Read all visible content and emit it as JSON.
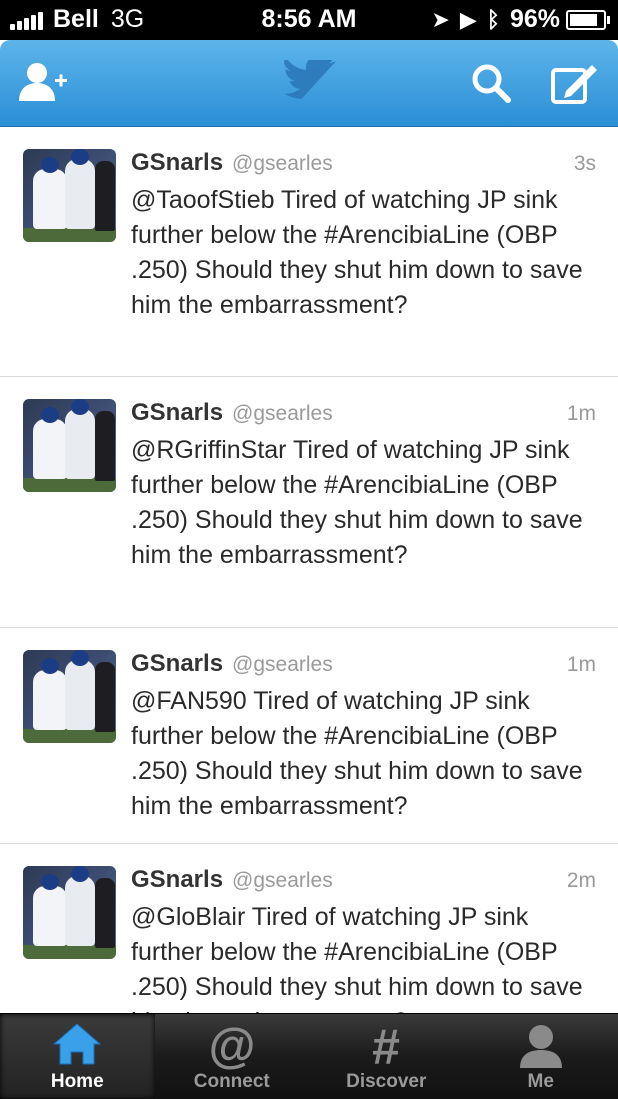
{
  "status_bar": {
    "carrier": "Bell",
    "network": "3G",
    "time": "8:56 AM",
    "battery": "96%",
    "battery_level": 0.96,
    "signal_bars": 5
  },
  "nav": {
    "add_user_icon": "add-user-icon",
    "logo_icon": "twitter-bird-icon",
    "search_icon": "search-icon",
    "compose_icon": "compose-icon",
    "accent_color": "#3a9be0"
  },
  "tweets": [
    {
      "name": "GSnarls",
      "handle": "@gsearles",
      "time": "3s",
      "text": "@TaoofStieb Tired of watching JP sink further below the #ArencibiaLine (OBP .250) Should they shut him down to save him the embarrassment?"
    },
    {
      "name": "GSnarls",
      "handle": "@gsearles",
      "time": "1m",
      "text": "@RGriffinStar Tired of watching JP sink further below the #ArencibiaLine (OBP .250) Should they shut him down to save him the embarrassment?"
    },
    {
      "name": "GSnarls",
      "handle": "@gsearles",
      "time": "1m",
      "text": "@FAN590 Tired of watching JP sink further below the #ArencibiaLine (OBP .250) Should they shut him down to save him the embarrassment?"
    },
    {
      "name": "GSnarls",
      "handle": "@gsearles",
      "time": "2m",
      "text": "@GloBlair Tired of watching JP sink further below the #ArencibiaLine (OBP .250) Should they shut him down to save him the embarrassment?"
    }
  ],
  "tabs": [
    {
      "label": "Home",
      "icon": "home-icon",
      "active": true
    },
    {
      "label": "Connect",
      "icon": "at-sign-icon",
      "active": false
    },
    {
      "label": "Discover",
      "icon": "hashtag-icon",
      "active": false
    },
    {
      "label": "Me",
      "icon": "person-icon",
      "active": false
    }
  ]
}
